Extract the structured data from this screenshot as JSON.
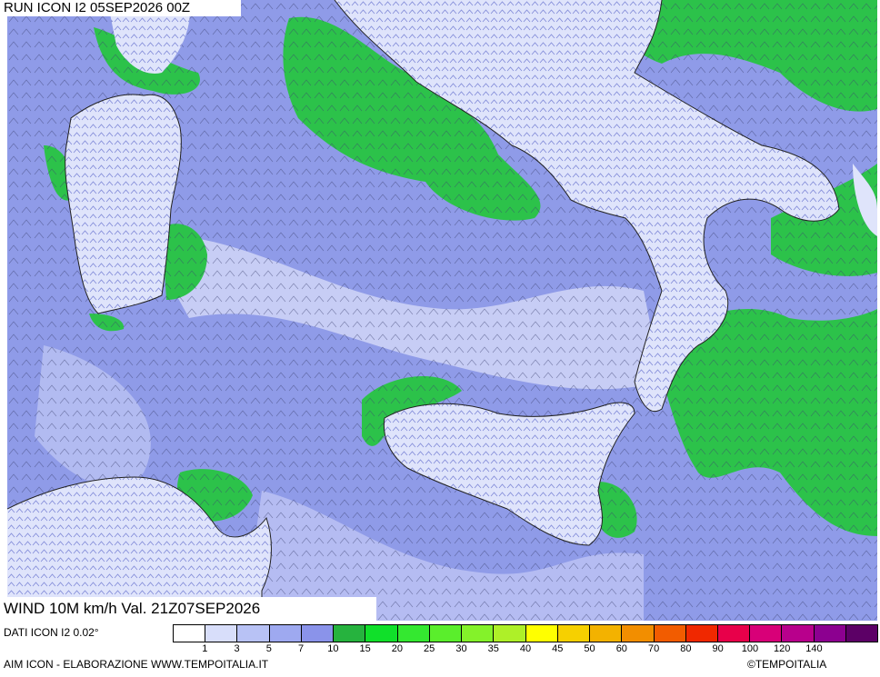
{
  "header": {
    "run_label": "RUN ICON I2 05SEP2026 00Z"
  },
  "map": {
    "sea_color": "#8f9be8",
    "land_color": "#dfe4fb",
    "green_color": "#2cc24a",
    "coast_color": "#222222"
  },
  "footer": {
    "wind_label": "WIND 10M km/h Val. 21Z07SEP2026",
    "dati_label": "DATI ICON I2 0.02°",
    "credit_label": "AIM ICON - ELABORAZIONE WWW.TEMPOITALIA.IT",
    "copyright": "©TEMPOITALIA"
  },
  "legend": {
    "colors": [
      "#ffffff",
      "#d8defa",
      "#b8c2f5",
      "#9ea9f0",
      "#8a93ea",
      "#26b33e",
      "#10e02a",
      "#34e830",
      "#5aee2c",
      "#84f22a",
      "#aef028",
      "#ffff00",
      "#f6d000",
      "#f3b200",
      "#f28e00",
      "#f25c00",
      "#f02800",
      "#e8004a",
      "#d80078",
      "#b8008c",
      "#8c0090",
      "#5c0066"
    ],
    "tick_labels": [
      "1",
      "3",
      "5",
      "7",
      "10",
      "15",
      "20",
      "25",
      "30",
      "35",
      "40",
      "45",
      "50",
      "60",
      "70",
      "80",
      "90",
      "100",
      "120",
      "140"
    ]
  }
}
